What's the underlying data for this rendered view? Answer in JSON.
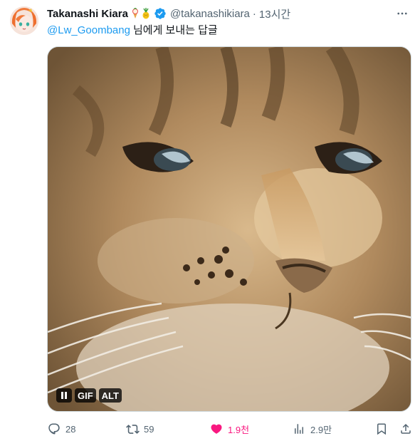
{
  "tweet": {
    "author_name": "Takanashi Kiara",
    "handle": "@takanashikiara",
    "separator": "·",
    "time": "13시간",
    "reply_mention": "@Lw_Goombang",
    "reply_text": "님에게 보내는 답글",
    "name_emoji": [
      "ice-cream-pineapple-icon",
      "pineapple-icon"
    ],
    "verified_color": "#1d9bf0"
  },
  "media": {
    "type": "GIF",
    "controls": {
      "pause_icon": "pause-icon",
      "gif_label": "GIF",
      "alt_label": "ALT"
    }
  },
  "actions": {
    "reply_count": "28",
    "retweet_count": "59",
    "like_count": "1.9천",
    "like_color": "#f91880",
    "views_count": "2.9만"
  }
}
